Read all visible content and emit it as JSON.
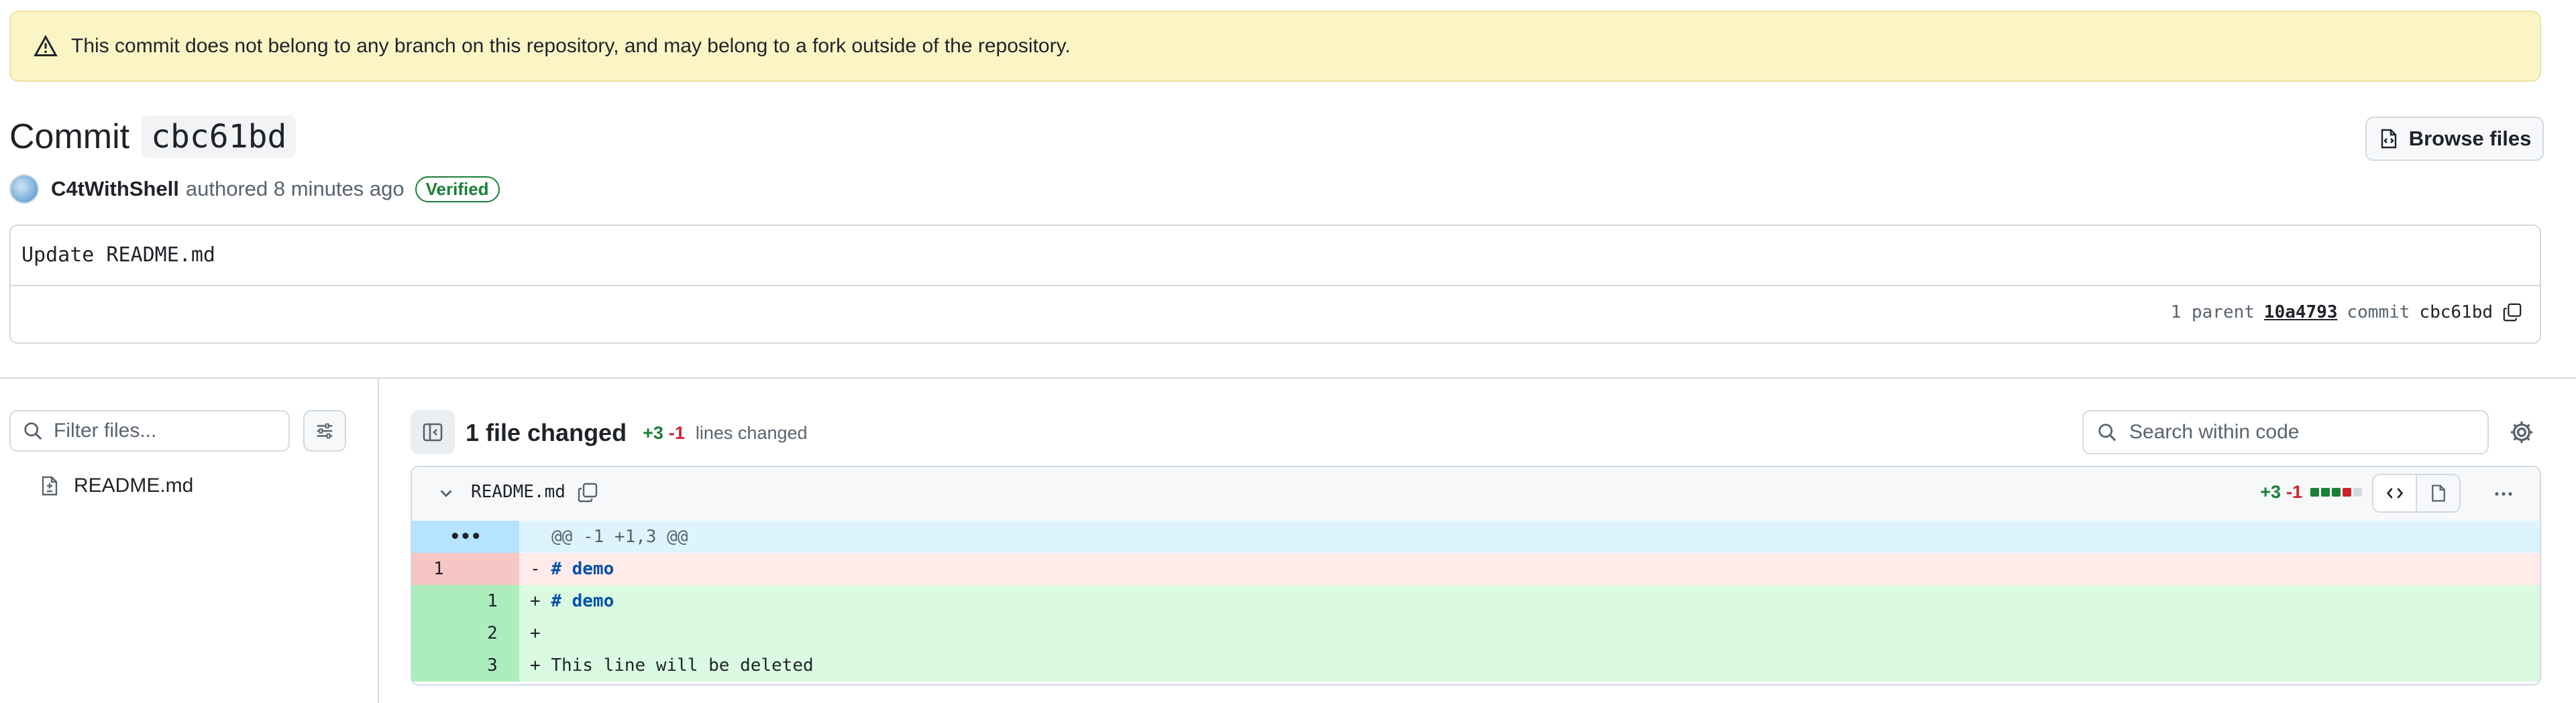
{
  "banner": {
    "text": "This commit does not belong to any branch on this repository, and may belong to a fork outside of the repository."
  },
  "commit": {
    "title_label": "Commit",
    "hash_short": "cbc61bd",
    "browse_label": "Browse files",
    "author": "C4tWithShell",
    "authored_text": "authored 8 minutes ago",
    "verified_label": "Verified",
    "message": "Update README.md",
    "parent_label": "1 parent",
    "parent_hash": "10a4793",
    "commit_label": "commit",
    "commit_hash": "cbc61bd"
  },
  "sidebar": {
    "filter_placeholder": "Filter files...",
    "files": [
      {
        "name": "README.md"
      }
    ]
  },
  "toolbar": {
    "files_changed": "1 file changed",
    "additions": "+3",
    "deletions": "-1",
    "lines_changed_label": "lines changed",
    "search_placeholder": "Search within code"
  },
  "diff": {
    "filename": "README.md",
    "additions": "+3",
    "deletions": "-1",
    "blocks": [
      "green",
      "green",
      "green",
      "red",
      "gray"
    ],
    "hunk_expander": "•••",
    "hunk_header": "@@ -1 +1,3 @@",
    "lines": [
      {
        "type": "del",
        "old": "1",
        "new": "",
        "sign": "-",
        "keyword": "# demo",
        "text": ""
      },
      {
        "type": "add",
        "old": "",
        "new": "1",
        "sign": "+",
        "keyword": "# demo",
        "text": ""
      },
      {
        "type": "add",
        "old": "",
        "new": "2",
        "sign": "+",
        "keyword": "",
        "text": ""
      },
      {
        "type": "add",
        "old": "",
        "new": "3",
        "sign": "+",
        "keyword": "",
        "text": "This line will be deleted"
      }
    ]
  },
  "colors": {
    "addition": "#1a7f37",
    "deletion": "#d1242f",
    "add_bg": "#dafbe1",
    "add_num_bg": "#aceebb",
    "del_bg": "#ffebe9",
    "del_num_bg": "#f5c6c3",
    "hunk_bg": "#ddf4ff",
    "hunk_num_bg": "#b6e3ff"
  }
}
